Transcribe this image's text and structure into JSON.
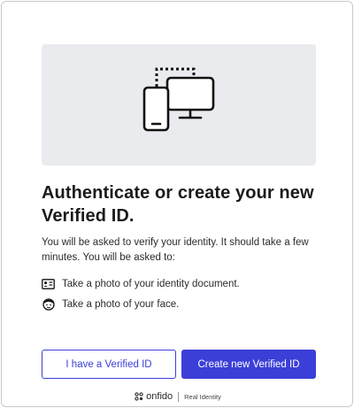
{
  "hero": {
    "illustration": "phone-and-monitor-icon"
  },
  "title": "Authenticate or create your new Verified ID.",
  "description": "You will be asked to verify your identity. It should take a few minutes. You will be asked to:",
  "steps": [
    {
      "icon": "id-card-icon",
      "label": "Take a photo of your identity document."
    },
    {
      "icon": "face-icon",
      "label": "Take a photo of your face."
    }
  ],
  "buttons": {
    "secondary_label": "I have a Verified ID",
    "primary_label": "Create new Verified ID"
  },
  "colors": {
    "accent": "#3b3fd8",
    "hero_bg": "#e9ebee"
  },
  "footer": {
    "brand": "onfido",
    "tagline": "Real Identity"
  }
}
